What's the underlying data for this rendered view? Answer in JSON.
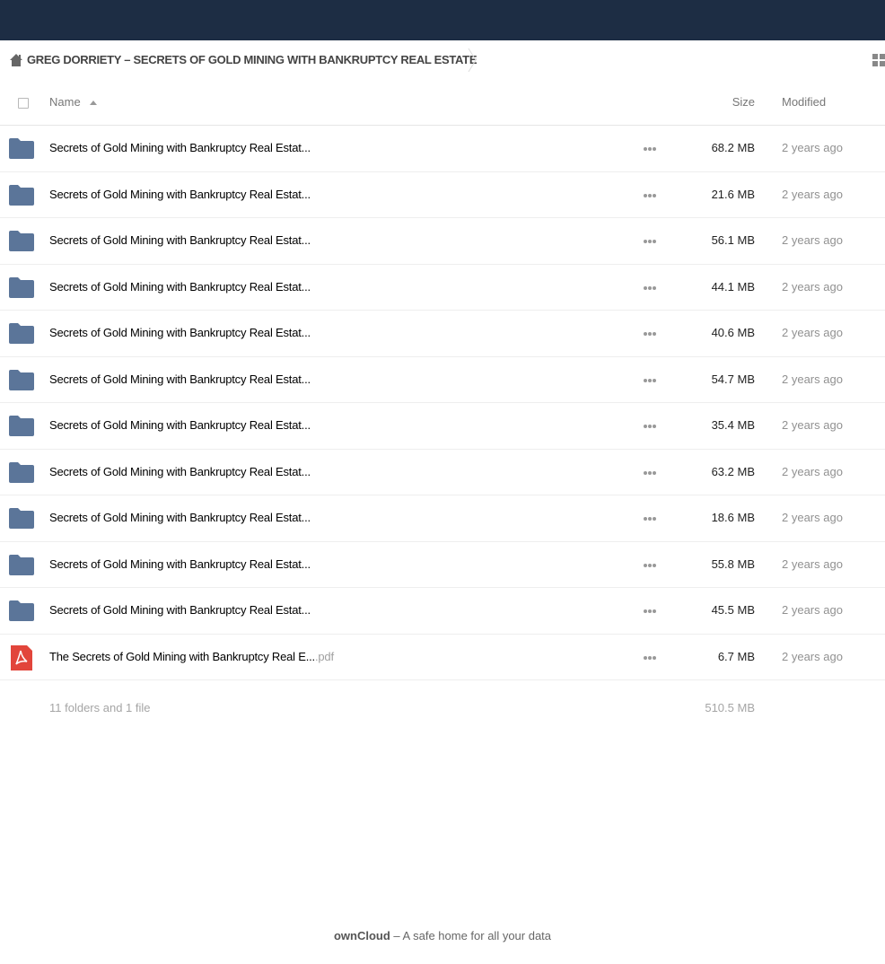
{
  "breadcrumb": {
    "home_icon": "home-icon",
    "current": "GREG DORRIETY – SECRETS OF GOLD MINING WITH BANKRUPTCY REAL ESTATE"
  },
  "header": {
    "name_label": "Name",
    "size_label": "Size",
    "modified_label": "Modified"
  },
  "colors": {
    "topbar": "#1d2d44",
    "folder": "#5b7599",
    "pdf": "#e2453b"
  },
  "files": [
    {
      "type": "folder",
      "name": "Secrets of Gold Mining with Bankruptcy Real Estat...",
      "ext": "",
      "size": "68.2 MB",
      "modified": "2 years ago"
    },
    {
      "type": "folder",
      "name": "Secrets of Gold Mining with Bankruptcy Real Estat...",
      "ext": "",
      "size": "21.6 MB",
      "modified": "2 years ago"
    },
    {
      "type": "folder",
      "name": "Secrets of Gold Mining with Bankruptcy Real Estat...",
      "ext": "",
      "size": "56.1 MB",
      "modified": "2 years ago"
    },
    {
      "type": "folder",
      "name": "Secrets of Gold Mining with Bankruptcy Real Estat...",
      "ext": "",
      "size": "44.1 MB",
      "modified": "2 years ago"
    },
    {
      "type": "folder",
      "name": "Secrets of Gold Mining with Bankruptcy Real Estat...",
      "ext": "",
      "size": "40.6 MB",
      "modified": "2 years ago"
    },
    {
      "type": "folder",
      "name": "Secrets of Gold Mining with Bankruptcy Real Estat...",
      "ext": "",
      "size": "54.7 MB",
      "modified": "2 years ago"
    },
    {
      "type": "folder",
      "name": "Secrets of Gold Mining with Bankruptcy Real Estat...",
      "ext": "",
      "size": "35.4 MB",
      "modified": "2 years ago"
    },
    {
      "type": "folder",
      "name": "Secrets of Gold Mining with Bankruptcy Real Estat...",
      "ext": "",
      "size": "63.2 MB",
      "modified": "2 years ago"
    },
    {
      "type": "folder",
      "name": "Secrets of Gold Mining with Bankruptcy Real Estat...",
      "ext": "",
      "size": "18.6 MB",
      "modified": "2 years ago"
    },
    {
      "type": "folder",
      "name": "Secrets of Gold Mining with Bankruptcy Real Estat...",
      "ext": "",
      "size": "55.8 MB",
      "modified": "2 years ago"
    },
    {
      "type": "folder",
      "name": "Secrets of Gold Mining with Bankruptcy Real Estat...",
      "ext": "",
      "size": "45.5 MB",
      "modified": "2 years ago"
    },
    {
      "type": "pdf",
      "name": "The Secrets of Gold Mining with Bankruptcy Real E...",
      "ext": ".pdf",
      "size": "6.7 MB",
      "modified": "2 years ago"
    }
  ],
  "summary": {
    "text": "11 folders and 1 file",
    "total_size": "510.5 MB"
  },
  "footer": {
    "brand": "ownCloud",
    "tagline": " – A safe home for all your data"
  }
}
